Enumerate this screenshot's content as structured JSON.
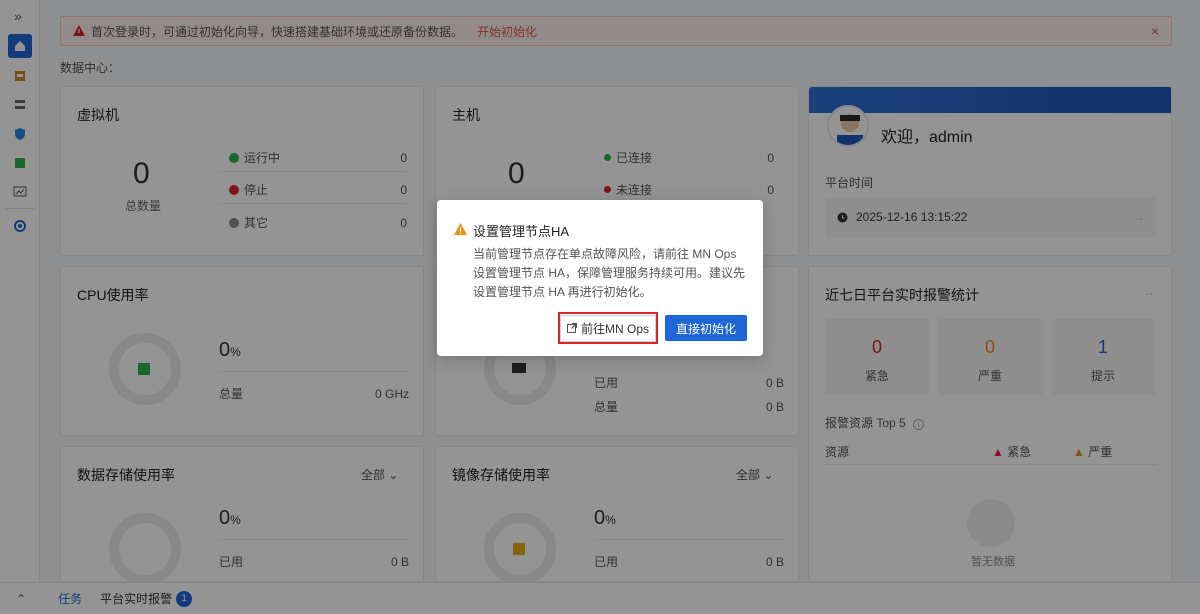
{
  "sidebar": {
    "expand_icon": "»"
  },
  "alert": {
    "text": "首次登录时，可通过初始化向导，快速搭建基础环境或还原备份数据。",
    "link": "开始初始化",
    "close": "×"
  },
  "section_title": "数据中心：",
  "vm_card": {
    "title": "虚拟机",
    "total": "0",
    "total_label": "总数量",
    "rows": [
      {
        "label": "运行中",
        "value": "0",
        "color": "#2db14a"
      },
      {
        "label": "停止",
        "value": "0",
        "color": "#d9232d"
      },
      {
        "label": "其它",
        "value": "0",
        "color": "#8c8c8c"
      }
    ]
  },
  "host_card": {
    "title": "主机",
    "total": "0",
    "rows": [
      {
        "label": "已连接",
        "value": "0",
        "color": "#2db14a"
      },
      {
        "label": "未连接",
        "value": "0",
        "color": "#d9232d"
      }
    ]
  },
  "welcome": {
    "greeting": "欢迎，admin",
    "platform_time_label": "平台时间",
    "platform_time": "2025-12-16 13:15:22"
  },
  "cpu_card": {
    "title": "CPU使用率",
    "percent": "0",
    "unit": "%",
    "total_label": "总量",
    "total_value": "0 GHz"
  },
  "mem_card": {
    "used_label": "已用",
    "used_value": "0 B",
    "total_label": "总量",
    "total_value": "0 B"
  },
  "alarm_card": {
    "title": "近七日平台实时报警统计",
    "boxes": [
      {
        "value": "0",
        "label": "紧急",
        "color": "#d9232d"
      },
      {
        "value": "0",
        "label": "严重",
        "color": "#e98c1a"
      },
      {
        "value": "1",
        "label": "提示",
        "color": "#1e66d6"
      }
    ],
    "top5_label": "报警资源 Top 5",
    "col_resource": "资源",
    "col_urgent": "紧急",
    "col_severe": "严重",
    "empty": "暂无数据"
  },
  "storage_card": {
    "title": "数据存储使用率",
    "filter": "全部",
    "percent": "0",
    "unit": "%",
    "used_label": "已用",
    "used_value": "0 B"
  },
  "image_card": {
    "title": "镜像存储使用率",
    "filter": "全部",
    "percent": "0",
    "unit": "%",
    "used_label": "已用",
    "used_value": "0 B"
  },
  "taskbar": {
    "tasks": "任务",
    "alarms": "平台实时报警",
    "alarm_count": "1"
  },
  "dialog": {
    "title": "设置管理节点HA",
    "body": "当前管理节点存在单点故障风险，请前往 MN Ops 设置管理节点 HA，保障管理服务持续可用。建议先设置管理节点 HA 再进行初始化。",
    "btn_goto": "前往MN Ops",
    "btn_init": "直接初始化"
  },
  "colors": {
    "accent": "#1e66d6",
    "danger": "#d9232d",
    "warning": "#e98c1a"
  }
}
